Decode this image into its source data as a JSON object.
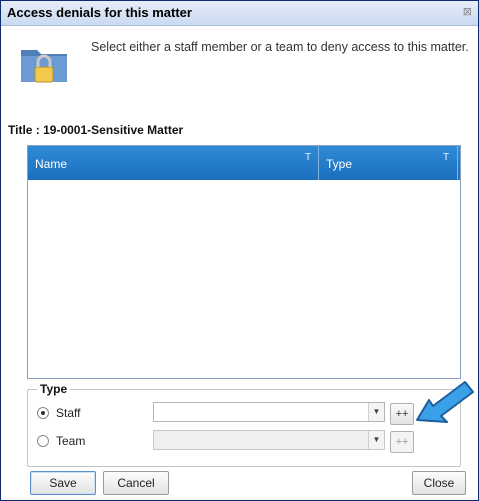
{
  "window": {
    "title": "Access denials for this matter"
  },
  "header": {
    "description": "Select either a staff member or a team to deny access to this matter."
  },
  "matter": {
    "title_text": "Title : 19-0001-Sensitive Matter"
  },
  "grid": {
    "columns": [
      {
        "label": "Name",
        "filter": "T"
      },
      {
        "label": "Type",
        "filter": "T"
      }
    ]
  },
  "type_group": {
    "legend": "Type",
    "options": [
      {
        "label": "Staff",
        "checked": true,
        "combo_value": "",
        "add_label": "++"
      },
      {
        "label": "Team",
        "checked": false,
        "combo_value": "",
        "add_label": "++"
      }
    ]
  },
  "buttons": {
    "save": "Save",
    "cancel": "Cancel",
    "close": "Close"
  },
  "colors": {
    "grid_header": "#1f78c8",
    "callout_arrow": "#3aa0e8",
    "titlebar": "#d5e3f5"
  },
  "icons": {
    "header": "locked-folder-icon",
    "callout": "blue-arrow-icon"
  }
}
